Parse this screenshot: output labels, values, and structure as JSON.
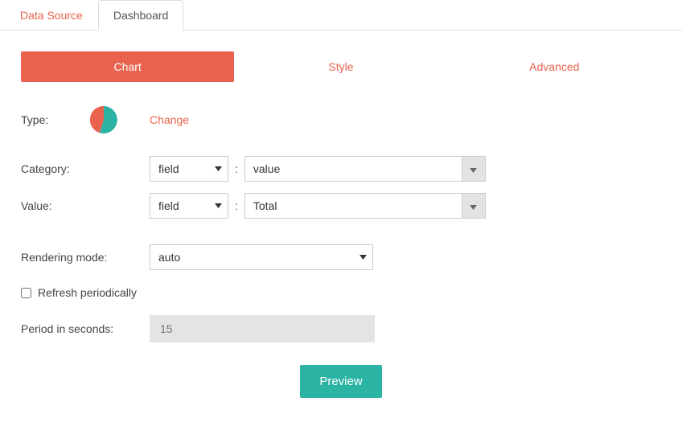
{
  "tabs": {
    "data_source": "Data Source",
    "dashboard": "Dashboard"
  },
  "subtabs": {
    "chart": "Chart",
    "style": "Style",
    "advanced": "Advanced"
  },
  "type": {
    "label": "Type:",
    "change": "Change"
  },
  "category": {
    "label": "Category:",
    "select": "field",
    "value": "value"
  },
  "value": {
    "label": "Value:",
    "select": "field",
    "value": "Total"
  },
  "rendering": {
    "label": "Rendering mode:",
    "select": "auto"
  },
  "refresh": {
    "label": "Refresh periodically"
  },
  "period": {
    "label": "Period in seconds:",
    "placeholder": "15"
  },
  "preview": "Preview"
}
